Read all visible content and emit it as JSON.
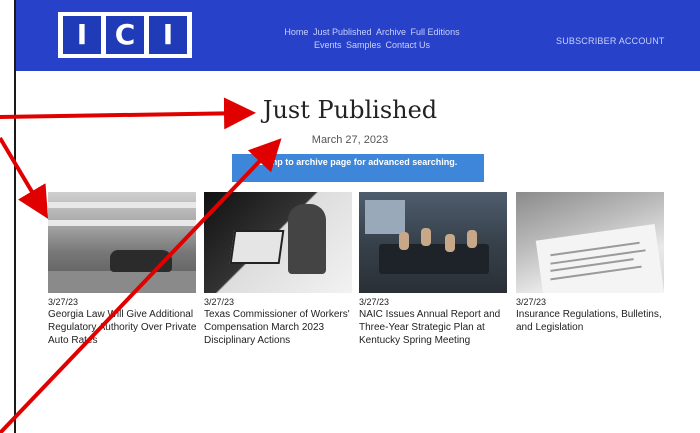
{
  "header": {
    "logo_letters": [
      "I",
      "C",
      "I"
    ],
    "nav": [
      "Home",
      "Just Published",
      "Archive",
      "Full Editions",
      "Events",
      "Samples",
      "Contact Us"
    ],
    "subscriber": "SUBSCRIBER ACCOUNT"
  },
  "main": {
    "title": "Just Published",
    "date": "March 27, 2023",
    "archive_button": "Jump to archive page for advanced searching."
  },
  "articles": [
    {
      "date": "3/27/23",
      "headline": "Georgia Law Will Give Additional Regulatory Authority Over Private Auto Rates"
    },
    {
      "date": "3/27/23",
      "headline": "Texas Commissioner of Workers' Compensation March 2023 Disciplinary Actions"
    },
    {
      "date": "3/27/23",
      "headline": "NAIC Issues Annual Report and Three-Year Strategic Plan at Kentucky Spring Meeting"
    },
    {
      "date": "3/27/23",
      "headline": "Insurance Regulations, Bulletins, and Legislation"
    }
  ],
  "colors": {
    "header": "#2741c9",
    "button": "#3d86d9",
    "arrow": "#e00000"
  }
}
